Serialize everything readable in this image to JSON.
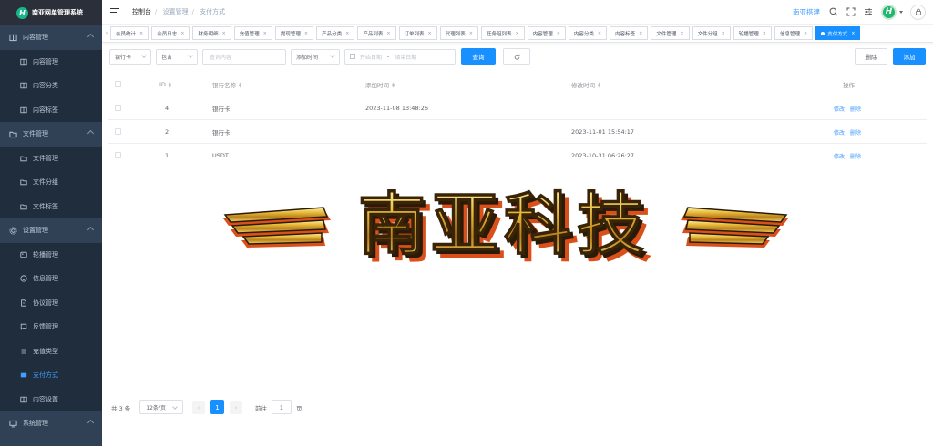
{
  "colors": {
    "sidebar_bg": "#304156",
    "sidebar_sub_bg": "#1f2d3d",
    "accent": "#1890ff",
    "link": "#409eff",
    "logo_green": "#19b68c"
  },
  "app": {
    "logo_letter": "H",
    "title": "南亚网单管理系统"
  },
  "sidebar": {
    "groups": [
      {
        "label": "内容管理",
        "icon": "book-icon",
        "items": [
          {
            "label": "内容管理",
            "icon": "book-icon"
          },
          {
            "label": "内容分类",
            "icon": "book-icon"
          },
          {
            "label": "内容标签",
            "icon": "book-icon"
          }
        ]
      },
      {
        "label": "文件管理",
        "icon": "folder-icon",
        "items": [
          {
            "label": "文件管理",
            "icon": "folder-icon"
          },
          {
            "label": "文件分组",
            "icon": "folder-icon"
          },
          {
            "label": "文件标签",
            "icon": "folder-icon"
          }
        ]
      },
      {
        "label": "设置管理",
        "icon": "gear-icon",
        "items": [
          {
            "label": "轮播管理",
            "icon": "image-icon"
          },
          {
            "label": "信息管理",
            "icon": "chat-icon"
          },
          {
            "label": "协议管理",
            "icon": "doc-icon"
          },
          {
            "label": "反馈管理",
            "icon": "feedback-icon"
          },
          {
            "label": "充值类型",
            "icon": "list-icon"
          },
          {
            "label": "支付方式",
            "icon": "card-icon",
            "active": true
          },
          {
            "label": "内容设置",
            "icon": "book-icon"
          }
        ]
      },
      {
        "label": "系统管理",
        "icon": "monitor-icon",
        "items": []
      }
    ]
  },
  "header": {
    "breadcrumb": [
      "控制台",
      "设置管理",
      "支付方式"
    ],
    "username": "南亚搭建",
    "avatar_letter": "H"
  },
  "tags": [
    {
      "label": "会员统计"
    },
    {
      "label": "会员日志"
    },
    {
      "label": "财务明细"
    },
    {
      "label": "充值管理"
    },
    {
      "label": "提现管理"
    },
    {
      "label": "产品分类"
    },
    {
      "label": "产品列表"
    },
    {
      "label": "订单列表"
    },
    {
      "label": "代理列表"
    },
    {
      "label": "任务组列表"
    },
    {
      "label": "内容管理"
    },
    {
      "label": "内容分类"
    },
    {
      "label": "内容标签"
    },
    {
      "label": "文件管理"
    },
    {
      "label": "文件分组"
    },
    {
      "label": "轮播管理"
    },
    {
      "label": "信息管理"
    },
    {
      "label": "支付方式",
      "active": true
    }
  ],
  "filters": {
    "field": "银行卡",
    "op": "包含",
    "search_placeholder": "查询内容",
    "date_field": "添加时间",
    "start_placeholder": "开始日期",
    "end_placeholder": "结束日期",
    "date_sep": "-",
    "query_label": "查询",
    "refresh_icon": "refresh-icon",
    "delete_label": "删除",
    "add_label": "添加"
  },
  "table": {
    "headers": {
      "id": "ID",
      "name": "银行名称",
      "create": "添加时间",
      "update": "修改时间",
      "ops": "操作"
    },
    "rows": [
      {
        "id": "4",
        "name": "银行卡",
        "create": "2023-11-08 13:48:26",
        "update": "",
        "edit": "修改",
        "del": "删除"
      },
      {
        "id": "2",
        "name": "银行卡",
        "create": "",
        "update": "2023-11-01 15:54:17",
        "edit": "修改",
        "del": "删除"
      },
      {
        "id": "1",
        "name": "USDT",
        "create": "",
        "update": "2023-10-31 06:26:27",
        "edit": "修改",
        "del": "删除"
      }
    ]
  },
  "banner": {
    "text": "南亚科技",
    "style": "gold-3d-winged-logo"
  },
  "pager": {
    "total": "共 3 条",
    "size": "12条/页",
    "current": "1",
    "goto_label": "前往",
    "goto_value": "1",
    "page_unit": "页"
  }
}
